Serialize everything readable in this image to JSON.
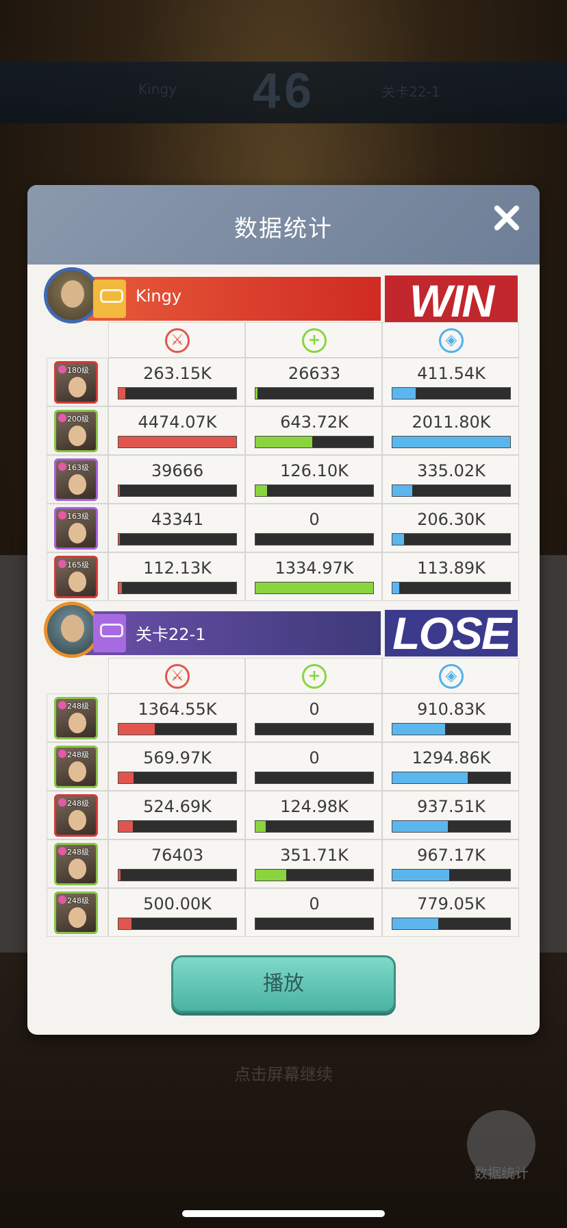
{
  "background": {
    "score": "46",
    "left_name": "Kingy",
    "right_name": "关卡22-1",
    "tap_hint": "点击屏幕继续",
    "stats_button": "数据统计"
  },
  "dialog": {
    "title": "数据统计",
    "play_label": "播放"
  },
  "team1": {
    "name": "Kingy",
    "result": "WIN",
    "heroes": [
      {
        "level": "180级",
        "frame": "red",
        "dmg": "263.15K",
        "heal": "26633",
        "def": "411.54K",
        "dmg_pct": 6,
        "heal_pct": 2,
        "def_pct": 20
      },
      {
        "level": "200级",
        "frame": "green",
        "dmg": "4474.07K",
        "heal": "643.72K",
        "def": "2011.80K",
        "dmg_pct": 100,
        "heal_pct": 48,
        "def_pct": 100
      },
      {
        "level": "163级",
        "frame": "purple",
        "dmg": "39666",
        "heal": "126.10K",
        "def": "335.02K",
        "dmg_pct": 1,
        "heal_pct": 10,
        "def_pct": 17
      },
      {
        "level": "163级",
        "frame": "purple",
        "dmg": "43341",
        "heal": "0",
        "def": "206.30K",
        "dmg_pct": 1,
        "heal_pct": 0,
        "def_pct": 10
      },
      {
        "level": "165级",
        "frame": "red",
        "dmg": "112.13K",
        "heal": "1334.97K",
        "def": "113.89K",
        "dmg_pct": 3,
        "heal_pct": 100,
        "def_pct": 6
      }
    ]
  },
  "team2": {
    "name": "关卡22-1",
    "result": "LOSE",
    "heroes": [
      {
        "level": "248级",
        "frame": "green",
        "dmg": "1364.55K",
        "heal": "0",
        "def": "910.83K",
        "dmg_pct": 31,
        "heal_pct": 0,
        "def_pct": 45
      },
      {
        "level": "248级",
        "frame": "green",
        "dmg": "569.97K",
        "heal": "0",
        "def": "1294.86K",
        "dmg_pct": 13,
        "heal_pct": 0,
        "def_pct": 64
      },
      {
        "level": "248级",
        "frame": "red",
        "dmg": "524.69K",
        "heal": "124.98K",
        "def": "937.51K",
        "dmg_pct": 12,
        "heal_pct": 9,
        "def_pct": 47
      },
      {
        "level": "248级",
        "frame": "green",
        "dmg": "76403",
        "heal": "351.71K",
        "def": "967.17K",
        "dmg_pct": 2,
        "heal_pct": 26,
        "def_pct": 48
      },
      {
        "level": "248级",
        "frame": "green",
        "dmg": "500.00K",
        "heal": "0",
        "def": "779.05K",
        "dmg_pct": 11,
        "heal_pct": 0,
        "def_pct": 39
      }
    ]
  },
  "colors": {
    "damage": "#e0564e",
    "heal": "#8ad43e",
    "defense": "#5cb6ee",
    "win": "#c1272d",
    "lose": "#3b3a8c",
    "play_button": "#5cc4b4"
  },
  "icons": {
    "damage": "sword-icon",
    "heal": "plus-icon",
    "defense": "shield-icon"
  }
}
